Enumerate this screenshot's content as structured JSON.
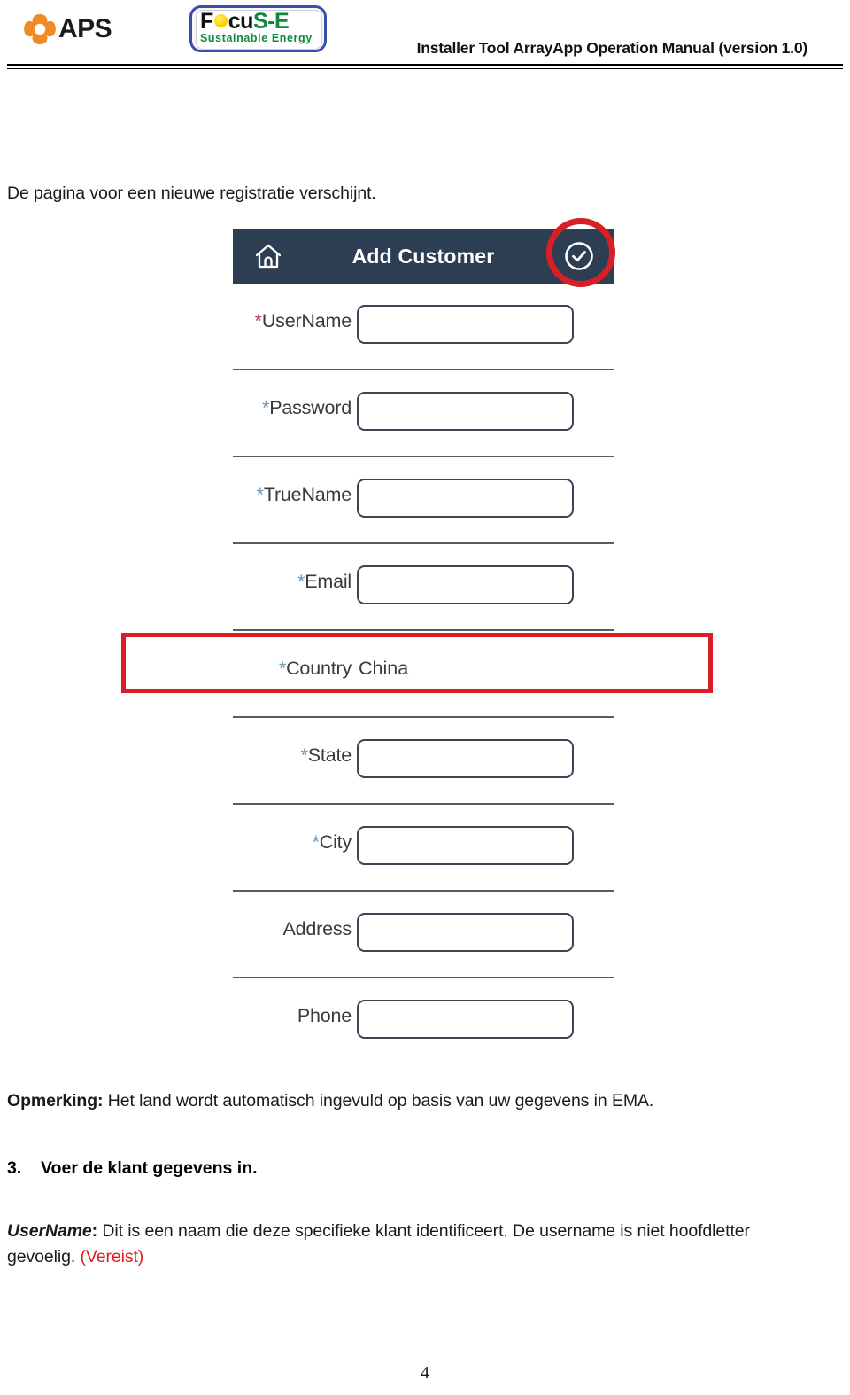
{
  "page_header": {
    "aps_logo_text": "APS",
    "aps_mark_icon": "aps-propeller-icon",
    "focuse_logo": {
      "part_f": "F",
      "sun_icon": "sun-dot-icon",
      "part_cu": "cu",
      "part_se": "S-E",
      "tagline": "Sustainable Energy"
    },
    "manual_title": "Installer Tool ArrayApp Operation Manual (version 1.0)"
  },
  "document": {
    "intro": "De pagina voor een nieuwe registratie verschijnt.",
    "note_label": "Opmerking:",
    "note_body": " Het land wordt automatisch ingevuld op basis van uw gegevens in EMA.",
    "step3_number": "3.",
    "step3_text": "Voer de klant gegevens in.",
    "username_term": "UserName",
    "username_colon": ":",
    "username_body": " Dit is een naam die deze specifieke klant identificeert. De username is niet hoofdletter gevoelig. ",
    "username_required": "(Vereist)",
    "page_number": "4"
  },
  "app": {
    "titlebar": {
      "home_icon": "home-icon",
      "title": "Add Customer",
      "confirm_icon": "check-circle-icon"
    },
    "fields": [
      {
        "asterisk": "*",
        "asterisk_style": "red",
        "label": "UserName",
        "type": "input",
        "value": ""
      },
      {
        "asterisk": "*",
        "asterisk_style": "blue",
        "label": "Password",
        "type": "input",
        "value": ""
      },
      {
        "asterisk": "*",
        "asterisk_style": "blue",
        "label": "TrueName",
        "type": "input",
        "value": ""
      },
      {
        "asterisk": "*",
        "asterisk_style": "blue",
        "label": "Email",
        "type": "input",
        "value": ""
      },
      {
        "asterisk": "*",
        "asterisk_style": "blue",
        "label": "Country",
        "type": "text",
        "value": "China"
      },
      {
        "asterisk": "*",
        "asterisk_style": "blue",
        "label": "State",
        "type": "input",
        "value": ""
      },
      {
        "asterisk": "*",
        "asterisk_style": "blue",
        "label": "City",
        "type": "input",
        "value": ""
      },
      {
        "asterisk": "",
        "asterisk_style": "blue",
        "label": "Address",
        "type": "input",
        "value": ""
      },
      {
        "asterisk": "",
        "asterisk_style": "blue",
        "label": "Phone",
        "type": "input",
        "value": ""
      }
    ]
  },
  "annotations": {
    "country_highlight_color": "#d81f26",
    "confirm_highlight_color": "#d81f26"
  },
  "colors": {
    "titlebar_bg": "#2e3e52",
    "annotation_red": "#d81f26",
    "required_red": "#e01b1b",
    "focuse_green": "#0f8a3c",
    "focuse_border_blue": "#3b4fa8",
    "aps_orange": "#f08a24"
  }
}
